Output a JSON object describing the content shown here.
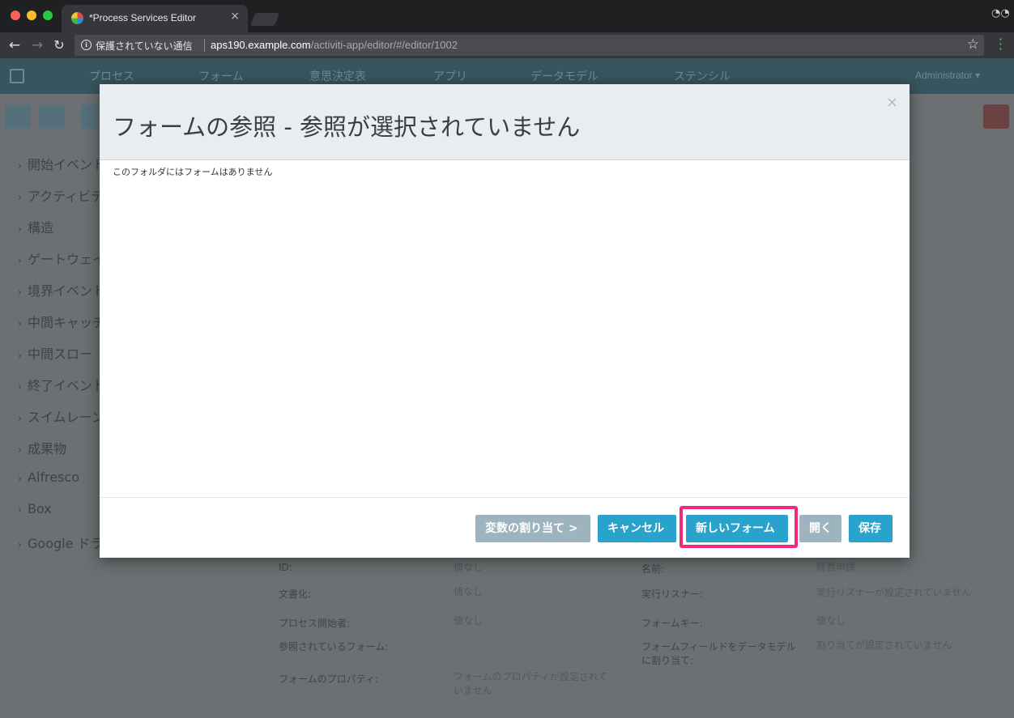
{
  "browser": {
    "tab_title": "*Process Services Editor",
    "tab_close": "×",
    "security_label": "保護されていない通信",
    "url_host": "aps190.example.com",
    "url_path": "/activiti-app/editor/#/editor/1002"
  },
  "app": {
    "nav_items": [
      "プロセス",
      "フォーム",
      "意思決定表",
      "アプリ",
      "データモデル",
      "ステンシル"
    ],
    "user": "Administrator ▾",
    "palette": [
      "開始イベント",
      "アクティビティ",
      "構造",
      "ゲートウェイ",
      "境界イベント",
      "中間キャッチ",
      "中間スロー",
      "終了イベント",
      "スイムレーン",
      "成果物",
      "Alfresco",
      "Box",
      "Google ドライブ"
    ],
    "properties": {
      "id_label": "ID:",
      "id_value": "値なし",
      "name_label": "名前:",
      "name_value": "経費申請",
      "doc_label": "文書化:",
      "doc_value": "値なし",
      "listener_label": "実行リスナー:",
      "listener_value": "実行リスナーが設定されていません",
      "initiator_label": "プロセス開始者:",
      "initiator_value": "値なし",
      "formkey_label": "フォームキー:",
      "formkey_value": "値なし",
      "refform_label": "参照されているフォーム:",
      "fieldmap_label": "フォームフィールドをデータモデルに割り当て:",
      "fieldmap_value": "割り当てが設定されていません",
      "formprops_label": "フォームのプロパティ:",
      "formprops_value": "フォームのプロパティが設定されていません"
    }
  },
  "modal": {
    "title": "フォームの参照 - 参照が選択されていません",
    "close": "×",
    "empty_message": "このフォルダにはフォームはありません",
    "buttons": {
      "assign_vars": "変数の割り当て >",
      "cancel": "キャンセル",
      "new_form": "新しいフォーム",
      "open": "開く",
      "save": "保存"
    }
  },
  "colors": {
    "modal_header": "#e8edf0",
    "button_blue": "#29a3cc",
    "button_gray": "#9db3bd",
    "highlight": "#ed2a7c"
  }
}
